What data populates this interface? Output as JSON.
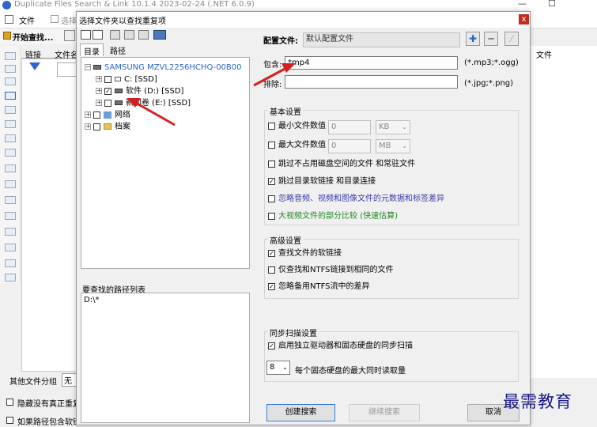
{
  "app": {
    "title": "Duplicate Files Search & Link 10.1.4 2023-02-24 (.NET 6.0.9)",
    "menu_file": "文件",
    "menu_select": "选择",
    "start_search": "开始查找...",
    "tab_link": "链接",
    "tab_filename": "文件名",
    "right_col": "文件",
    "other_group_label": "其他文件分组",
    "other_group_value": "无",
    "hide_unconfirmed": "隐藏没有真正重复",
    "if_path_contains": "如果路径包含软链"
  },
  "dialog": {
    "title": "选择文件夹以查找重复项",
    "close": "x",
    "tabs": [
      "目录",
      "路径"
    ],
    "tree": {
      "device": "SAMSUNG MZVL2256HCHQ-00B00",
      "drive_c": "C: [SSD]",
      "drive_d": "软件 (D:) [SSD]",
      "drive_e": "新加卷 (E:) [SSD]",
      "network": "网络",
      "archive": "档案"
    },
    "paths_label": "要查找的路径列表",
    "paths": [
      "D:\\*"
    ],
    "config": {
      "label": "配置文件:",
      "value": "默认配置文件",
      "include_label": "包含:",
      "include_value": "*mp4",
      "include_hint": "(*.mp3;*.ogg)",
      "exclude_label": "排除:",
      "exclude_value": "",
      "exclude_hint": "(*.jpg;*.png)"
    },
    "basic": {
      "title": "基本设置",
      "min_size_label": "最小文件数值",
      "min_size_value": "0",
      "min_unit": "KB",
      "max_size_label": "最大文件数值",
      "max_size_value": "0",
      "max_unit": "MB",
      "skip_zero": "跳过不占用磁盘空间的文件 和常驻文件",
      "skip_links": "跳过目录软链接 和目录连接",
      "ignore_meta": "忽略音频、视频和图像文件的元数据和标签差异",
      "partial_compare": "大视频文件的部分比较 (快速估算)"
    },
    "advanced": {
      "title": "高级设置",
      "find_softlinks": "查找文件的软链接",
      "only_ntfs": "仅查找和NTFS链接到相同的文件",
      "ignore_ntfs_streams": "忽略备用NTFS流中的差异"
    },
    "sync": {
      "title": "同步扫描设置",
      "enable_sync": "启用独立驱动器和固态硬盘的同步扫描",
      "max_reads_value": "8",
      "max_reads_label": "每个固态硬盘的最大同时读取量"
    },
    "buttons": {
      "create": "创建搜索",
      "continue": "继续搜索",
      "cancel": "取消"
    }
  },
  "watermark": "最需教育",
  "colors": {
    "accent_blue": "#2b65c9",
    "arrow_red": "#d42020",
    "purple_text": "#3c3ca8",
    "green_text": "#1f8a1f",
    "close_red": "#c42b1c"
  }
}
